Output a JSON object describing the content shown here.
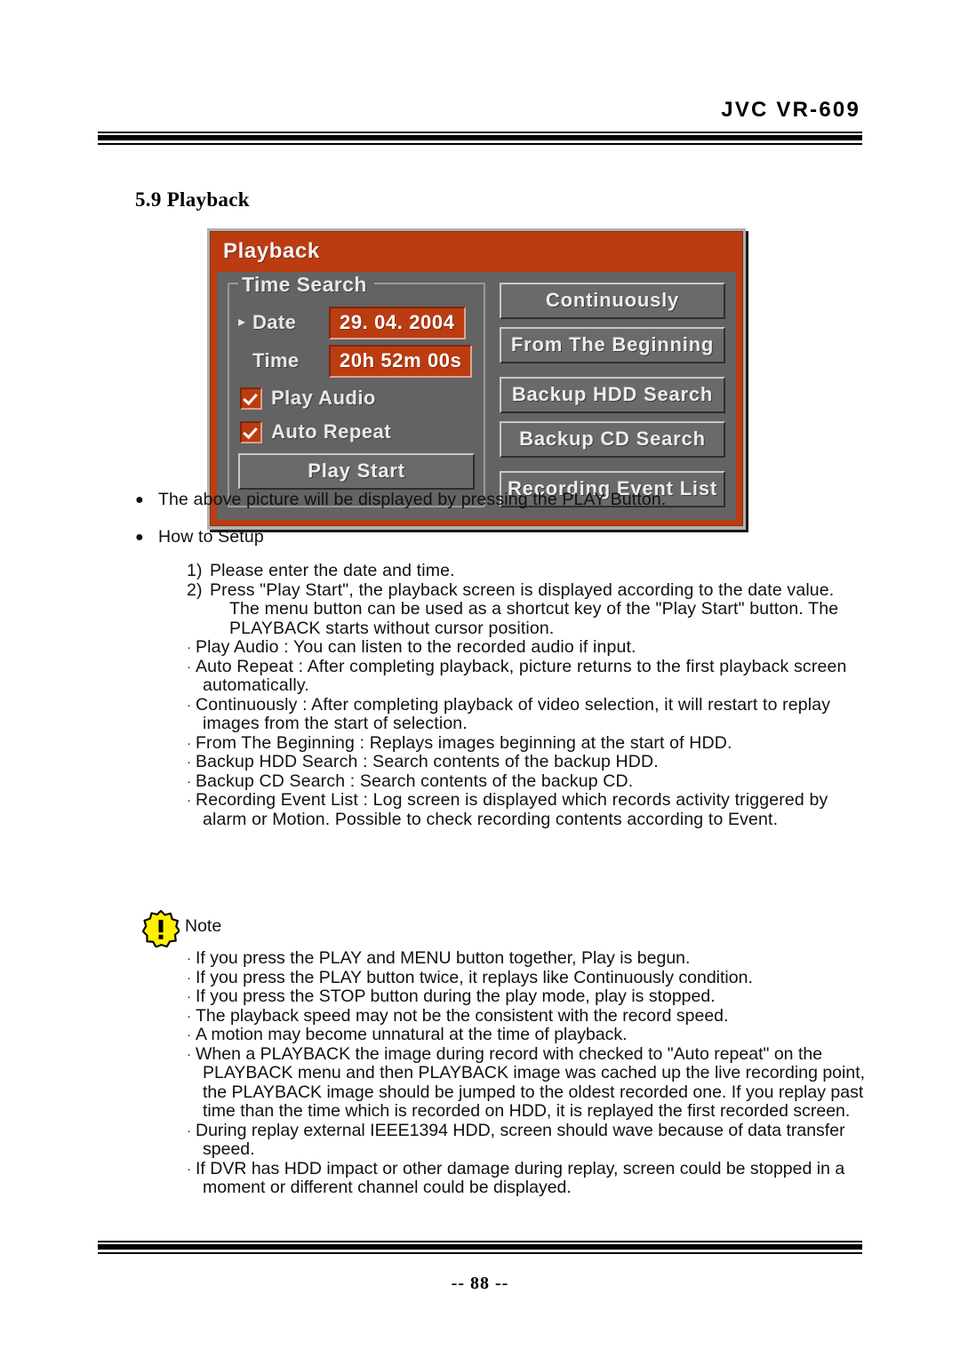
{
  "header": {
    "doc_title": "JVC VR-609"
  },
  "section": {
    "heading": "5.9 Playback"
  },
  "osd": {
    "title": "Playback",
    "group_legend": "Time Search",
    "cursor_marker": "▸",
    "fields": [
      {
        "label": "Date",
        "value": "29. 04. 2004",
        "selected": true
      },
      {
        "label": "Time",
        "value": "20h 52m 00s",
        "selected": false
      }
    ],
    "checkboxes": [
      {
        "label": "Play Audio",
        "checked": true
      },
      {
        "label": "Auto Repeat",
        "checked": true
      }
    ],
    "play_start_label": "Play Start",
    "right_buttons": [
      "Continuously",
      "From The Beginning",
      "Backup HDD Search",
      "Backup CD Search",
      "Recording Event List"
    ],
    "colors": {
      "accent": "#bc3c12",
      "panel": "#636363",
      "button": "#6a6a6a",
      "frame": "#b0b0b0"
    }
  },
  "body": {
    "bullet_glyph": "●",
    "dot_glyph": "·",
    "intro_bullet": "The above picture will be displayed by pressing the PLAY Button.",
    "howto_bullet": "How to Setup",
    "steps": [
      {
        "marker": "1)",
        "lines": [
          "Please enter the date and time."
        ]
      },
      {
        "marker": "2)",
        "lines": [
          "Press \"Play Start\", the playback screen is displayed according to the date value.",
          "The menu button can be used as a shortcut key of the \"Play Start\" button. The",
          "PLAYBACK starts without cursor position."
        ]
      }
    ],
    "descriptions": [
      {
        "lines": [
          "Play Audio : You can listen to the recorded audio if input."
        ]
      },
      {
        "lines": [
          "Auto Repeat : After completing playback, picture returns to the first playback screen",
          "automatically."
        ]
      },
      {
        "lines": [
          "Continuously : After completing playback of video selection, it will restart to replay",
          "images from the start of selection."
        ]
      },
      {
        "lines": [
          "From The Beginning : Replays images beginning at the start of HDD."
        ]
      },
      {
        "lines": [
          "Backup HDD Search : Search contents of the backup HDD."
        ]
      },
      {
        "lines": [
          "Backup CD Search : Search contents of the backup CD."
        ]
      },
      {
        "lines": [
          "Recording Event List : Log screen is displayed which records activity triggered by",
          "alarm or Motion. Possible to check recording contents according to Event."
        ]
      }
    ]
  },
  "note": {
    "icon_label": "!",
    "title": "Note",
    "items": [
      {
        "lines": [
          "If you press the PLAY  and MENU button together, Play is begun."
        ]
      },
      {
        "lines": [
          "If you press the PLAY button twice, it replays like Continuously condition."
        ]
      },
      {
        "lines": [
          "If you press the STOP button during the play mode, play is stopped."
        ]
      },
      {
        "lines": [
          "The playback speed may not be the consistent with the record speed."
        ]
      },
      {
        "lines": [
          "A motion may become unnatural at the time of playback."
        ]
      },
      {
        "lines": [
          "When a PLAYBACK the image during record with checked to \"Auto repeat\" on the",
          "PLAYBACK menu and then PLAYBACK image was cached up the live recording point,",
          "the PLAYBACK image should be jumped to the oldest recorded one. If you replay past",
          "time than the time which is recorded on HDD, it is replayed the first recorded screen."
        ]
      },
      {
        "lines": [
          "During replay external IEEE1394 HDD, screen should wave because of data transfer",
          "speed."
        ]
      },
      {
        "lines": [
          "If DVR has HDD impact or other damage during replay, screen could be stopped in a",
          "moment or different channel could be displayed."
        ]
      }
    ]
  },
  "footer": {
    "page_number": "-- 88 --"
  }
}
